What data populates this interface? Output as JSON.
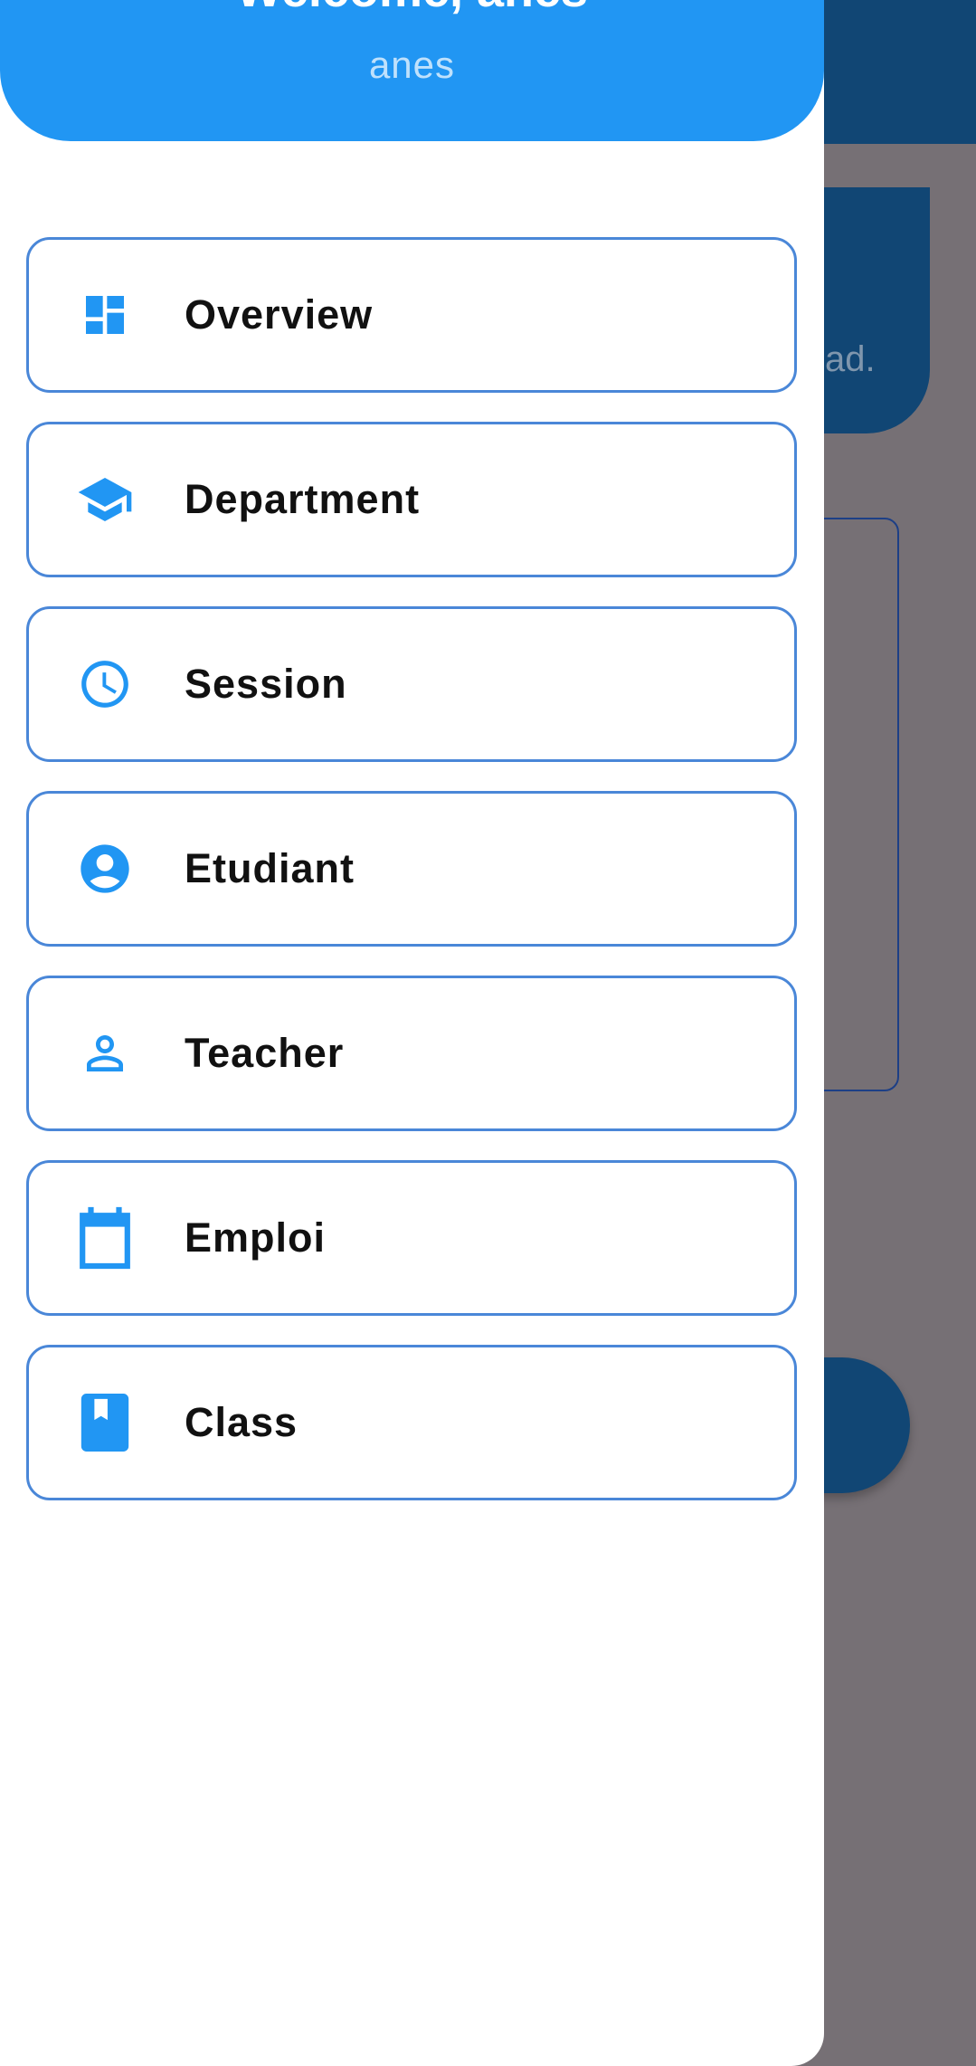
{
  "background": {
    "partial_text": "ad."
  },
  "drawer": {
    "welcome": "Welcome, anes",
    "username": "anes"
  },
  "menu": [
    {
      "label": "Overview",
      "icon": "dashboard-icon"
    },
    {
      "label": "Department",
      "icon": "school-icon"
    },
    {
      "label": "Session",
      "icon": "clock-icon"
    },
    {
      "label": "Etudiant",
      "icon": "account-circle-icon"
    },
    {
      "label": "Teacher",
      "icon": "person-outline-icon"
    },
    {
      "label": "Emploi",
      "icon": "calendar-icon"
    },
    {
      "label": "Class",
      "icon": "book-icon"
    }
  ],
  "colors": {
    "primary": "#2196f3",
    "appbar": "#114674",
    "scrim": "#767075",
    "item_border": "#4a87d8"
  }
}
